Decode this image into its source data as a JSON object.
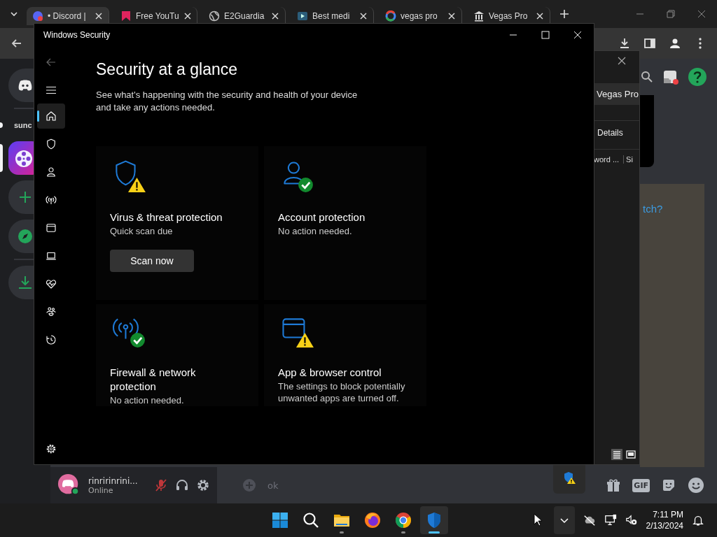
{
  "browser": {
    "tabs": [
      {
        "title": "• Discord |",
        "kind": "discord",
        "selected": true
      },
      {
        "title": "Free YouTu",
        "kind": "bookmark",
        "selected": false
      },
      {
        "title": "E2Guardia",
        "kind": "globe",
        "selected": false
      },
      {
        "title": "Best medi",
        "kind": "play",
        "selected": false
      },
      {
        "title": "vegas pro",
        "kind": "google",
        "selected": false
      },
      {
        "title": "Vegas Pro",
        "kind": "museum",
        "selected": false
      }
    ]
  },
  "discord": {
    "servers": [
      {
        "kind": "home",
        "selected": false
      },
      {
        "kind": "text",
        "label": "sunc",
        "selected": false
      },
      {
        "kind": "app",
        "selected": true
      },
      {
        "kind": "add",
        "selected": false
      },
      {
        "kind": "explore",
        "selected": false
      },
      {
        "kind": "download",
        "selected": false
      }
    ],
    "user": {
      "name": "rinririnrini...",
      "status": "Online",
      "muted": true
    },
    "message_input": {
      "value": "ok"
    },
    "link": "tch?",
    "gif_label": "GIF",
    "file_dialog": {
      "tab": "Vegas Pro",
      "section": "Details",
      "columns": [
        "word ...",
        "Si"
      ]
    }
  },
  "security_window": {
    "title": "Windows Security",
    "heading": "Security at a glance",
    "subtitle": "See what's happening with the security and health of your device and take any actions needed.",
    "nav": [
      {
        "kind": "home",
        "selected": true
      },
      {
        "kind": "shield",
        "selected": false
      },
      {
        "kind": "person",
        "selected": false
      },
      {
        "kind": "antenna",
        "selected": false
      },
      {
        "kind": "window",
        "selected": false
      },
      {
        "kind": "laptop",
        "selected": false
      },
      {
        "kind": "heart",
        "selected": false
      },
      {
        "kind": "family",
        "selected": false
      },
      {
        "kind": "history",
        "selected": false
      }
    ],
    "cards": [
      {
        "kind": "shield",
        "warning": true,
        "title": "Virus & threat protection",
        "status": "Quick scan due",
        "button": "Scan now"
      },
      {
        "kind": "person",
        "warning": false,
        "title": "Account protection",
        "status": "No action needed."
      },
      {
        "kind": "antenna",
        "warning": false,
        "title": "Firewall & network protection",
        "status": "No action needed."
      },
      {
        "kind": "window",
        "warning": true,
        "title": "App & browser control",
        "status": "The settings to block potentially unwanted apps are turned off."
      }
    ]
  },
  "taskbar": {
    "apps": [
      {
        "kind": "start",
        "running": false,
        "selected": false
      },
      {
        "kind": "search",
        "running": false,
        "selected": false
      },
      {
        "kind": "files",
        "running": true,
        "selected": false
      },
      {
        "kind": "firefox",
        "running": false,
        "selected": false
      },
      {
        "kind": "chrome",
        "running": true,
        "selected": false
      },
      {
        "kind": "security",
        "running": true,
        "selected": true
      }
    ],
    "time": "7:11 PM",
    "date": "2/13/2024"
  }
}
